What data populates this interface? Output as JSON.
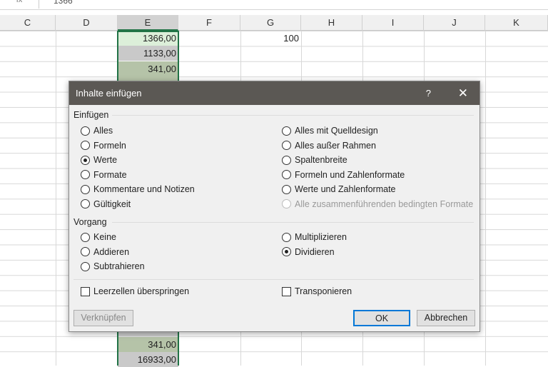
{
  "formula_bar": {
    "name_box": "fx",
    "value": "1366"
  },
  "columns": [
    "C",
    "D",
    "E",
    "F",
    "G",
    "H",
    "I",
    "J",
    "K"
  ],
  "selected_column": "E",
  "cells": {
    "E_top": [
      "1366,00",
      "1133,00",
      "341,00"
    ],
    "G1": "100",
    "E_bottom": [
      "341,00",
      "16933,00"
    ]
  },
  "dialog": {
    "title": "Inhalte einfügen",
    "help": "?",
    "close": "✕",
    "paste_group": "Einfügen",
    "paste_left": [
      {
        "label": "Alles",
        "checked": false
      },
      {
        "label": "Formeln",
        "checked": false
      },
      {
        "label": "Werte",
        "checked": true
      },
      {
        "label": "Formate",
        "checked": false
      },
      {
        "label": "Kommentare und Notizen",
        "checked": false
      },
      {
        "label": "Gültigkeit",
        "checked": false
      }
    ],
    "paste_right": [
      {
        "label": "Alles mit Quelldesign",
        "checked": false
      },
      {
        "label": "Alles außer Rahmen",
        "checked": false
      },
      {
        "label": "Spaltenbreite",
        "checked": false
      },
      {
        "label": "Formeln und Zahlenformate",
        "checked": false
      },
      {
        "label": "Werte und Zahlenformate",
        "checked": false
      },
      {
        "label": "Alle zusammenführenden bedingten Formate",
        "checked": false,
        "disabled": true
      }
    ],
    "operation_group": "Vorgang",
    "op_left": [
      {
        "label": "Keine",
        "checked": false
      },
      {
        "label": "Addieren",
        "checked": false
      },
      {
        "label": "Subtrahieren",
        "checked": false
      }
    ],
    "op_right": [
      {
        "label": "Multiplizieren",
        "checked": false
      },
      {
        "label": "Dividieren",
        "checked": true
      }
    ],
    "skip_blanks": {
      "label": "Leerzellen überspringen",
      "checked": false
    },
    "transpose": {
      "label": "Transponieren",
      "checked": false
    },
    "link_button": "Verknüpfen",
    "ok_button": "OK",
    "cancel_button": "Abbrechen"
  }
}
